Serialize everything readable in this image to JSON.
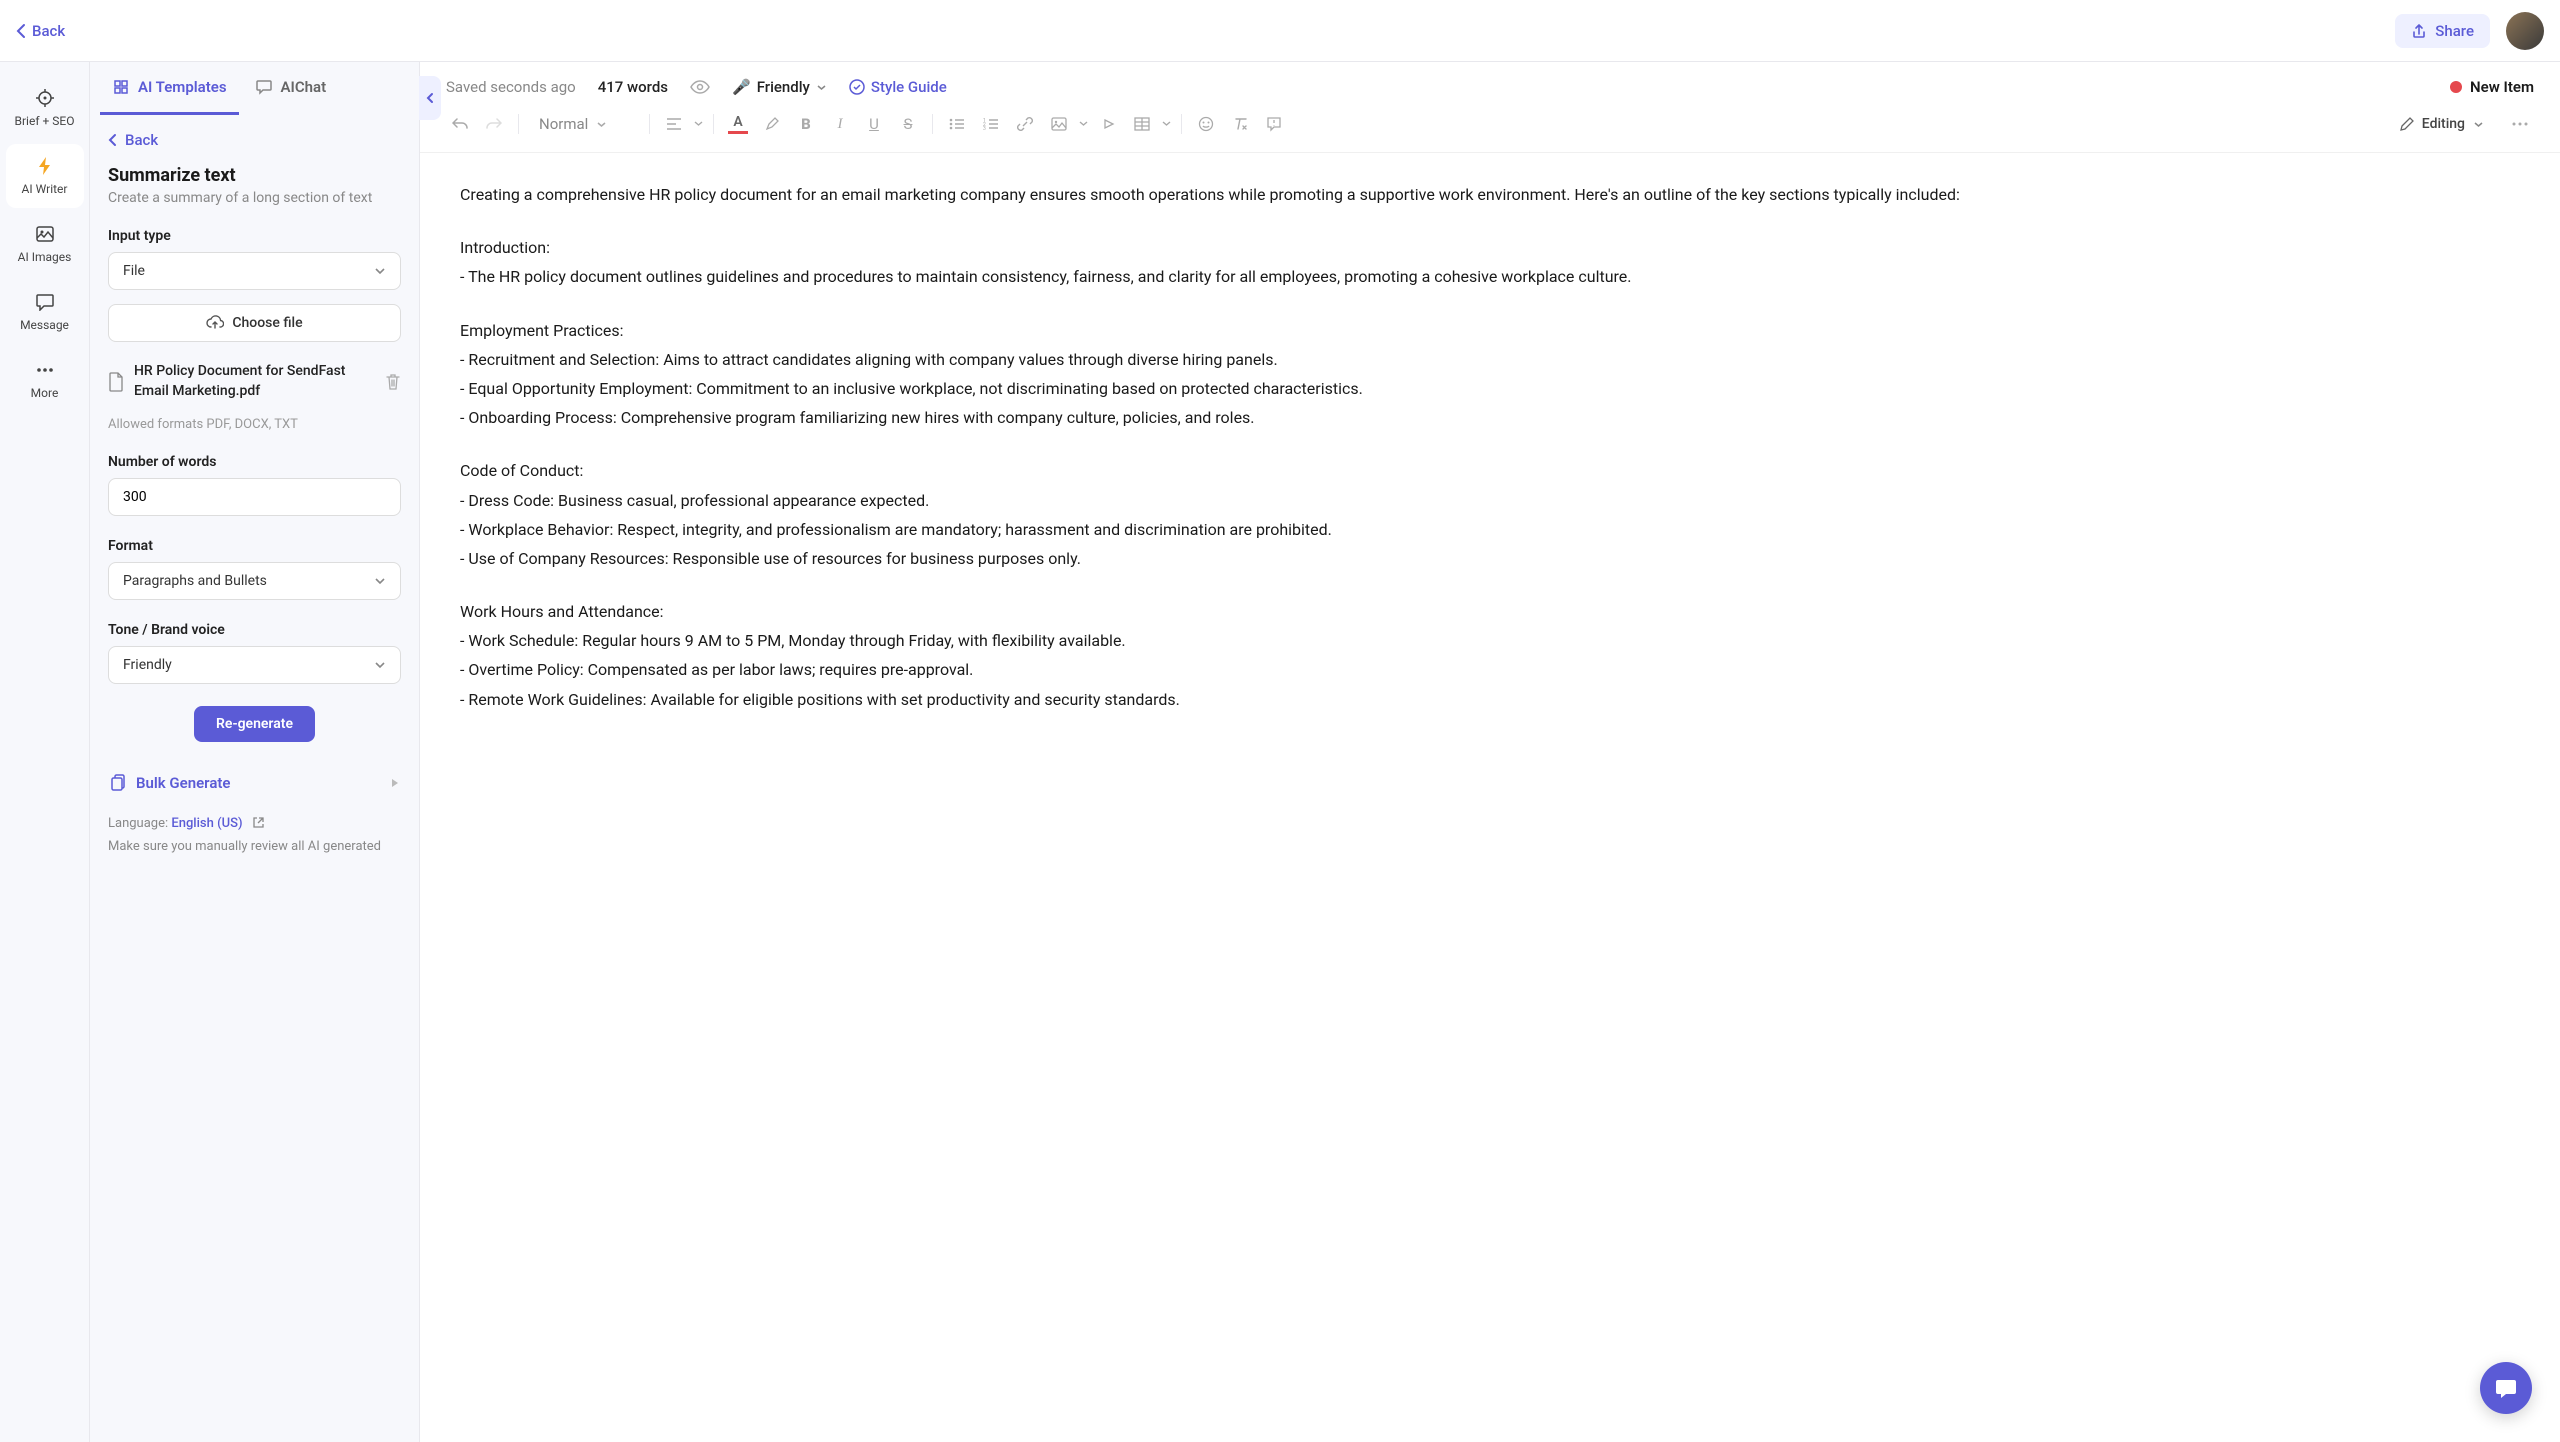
{
  "topbar": {
    "back": "Back",
    "share": "Share"
  },
  "rail": {
    "items": [
      {
        "label": "Brief + SEO"
      },
      {
        "label": "AI Writer"
      },
      {
        "label": "AI Images"
      },
      {
        "label": "Message"
      },
      {
        "label": "More"
      }
    ]
  },
  "panel": {
    "tabs": {
      "templates": "AI Templates",
      "chat": "AIChat"
    },
    "back": "Back",
    "title": "Summarize text",
    "subtitle": "Create a summary of a long section of text",
    "input_type_label": "Input type",
    "input_type_value": "File",
    "choose_file": "Choose file",
    "file_name": "HR Policy Document for SendFast Email Marketing.pdf",
    "allowed": "Allowed formats PDF, DOCX, TXT",
    "num_words_label": "Number of words",
    "num_words_value": "300",
    "format_label": "Format",
    "format_value": "Paragraphs and Bullets",
    "tone_label": "Tone / Brand voice",
    "tone_value": "Friendly",
    "regenerate": "Re-generate",
    "bulk": "Bulk Generate",
    "language_label": "Language: ",
    "language_value": "English (US)",
    "review_note": "Make sure you manually review all AI generated"
  },
  "editor": {
    "saved": "Saved seconds ago",
    "word_count": "417 words",
    "tone": "Friendly",
    "style_guide": "Style Guide",
    "new_item": "New Item",
    "text_style": "Normal",
    "mode": "Editing"
  },
  "document": {
    "intro": "Creating a comprehensive HR policy document for an email marketing company ensures smooth operations while promoting a supportive work environment. Here's an outline of the key sections typically included:",
    "s1_title": "Introduction:",
    "s1_b1": "- The HR policy document outlines guidelines and procedures to maintain consistency, fairness, and clarity for all employees, promoting a cohesive workplace culture.",
    "s2_title": "Employment Practices:",
    "s2_b1": "- Recruitment and Selection: Aims to attract candidates aligning with company values through diverse hiring panels.",
    "s2_b2": "- Equal Opportunity Employment: Commitment to an inclusive workplace, not discriminating based on protected characteristics.",
    "s2_b3": "- Onboarding Process: Comprehensive program familiarizing new hires with company culture, policies, and roles.",
    "s3_title": "Code of Conduct:",
    "s3_b1": "- Dress Code: Business casual, professional appearance expected.",
    "s3_b2": "- Workplace Behavior: Respect, integrity, and professionalism are mandatory; harassment and discrimination are prohibited.",
    "s3_b3": "- Use of Company Resources: Responsible use of resources for business purposes only.",
    "s4_title": "Work Hours and Attendance:",
    "s4_b1": "- Work Schedule: Regular hours 9 AM to 5 PM, Monday through Friday, with flexibility available.",
    "s4_b2": "- Overtime Policy: Compensated as per labor laws; requires pre-approval.",
    "s4_b3": "- Remote Work Guidelines: Available for eligible positions with set productivity and security standards."
  }
}
